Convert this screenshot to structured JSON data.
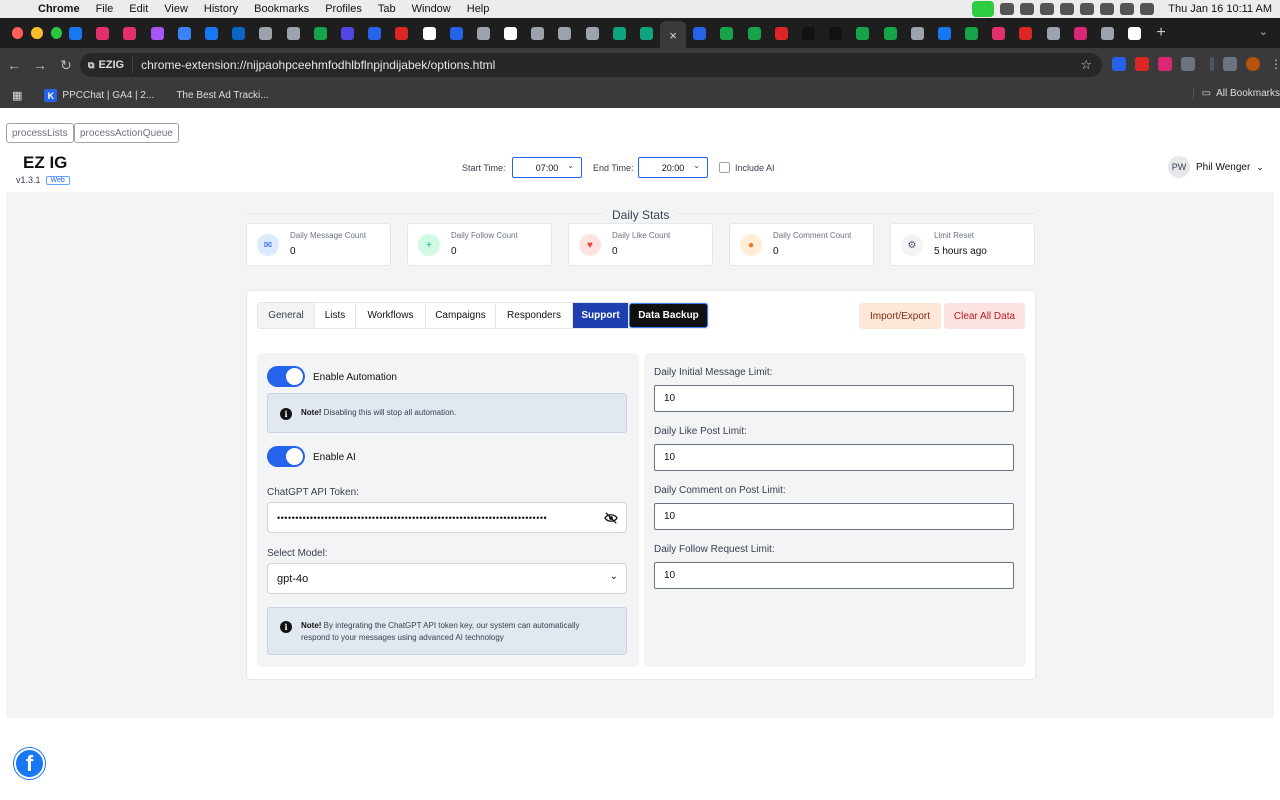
{
  "menubar": {
    "app": "Chrome",
    "items": [
      "File",
      "Edit",
      "View",
      "History",
      "Bookmarks",
      "Profiles",
      "Tab",
      "Window",
      "Help"
    ],
    "clock": "Thu Jan 16  10:11 AM"
  },
  "browser": {
    "url": "chrome-extension://nijpaohpceehmfodhlbflnpjndijabek/options.html",
    "site_chip": "EZIG",
    "new_tab": "+",
    "bookmarks": [
      {
        "label": "PPCChat | GA4 | 2...",
        "icon": "K"
      },
      {
        "label": "The Best Ad Tracki...",
        "icon": ""
      }
    ],
    "all_bookmarks": "All Bookmarks"
  },
  "debug_buttons": {
    "process_lists": "processLists",
    "process_action_queue": "processActionQueue"
  },
  "app": {
    "name": "EZ IG",
    "version": "v1.3.1",
    "badge": "Web"
  },
  "header": {
    "start_time_label": "Start Time:",
    "start_time": "07:00",
    "end_time_label": "End Time:",
    "end_time": "20:00",
    "include_ai_label": "Include AI",
    "user_initials": "PW",
    "user_name": "Phil Wenger"
  },
  "stats": {
    "title": "Daily Stats",
    "cards": [
      {
        "label": "Daily Message Count",
        "value": "0",
        "icon": "message-icon",
        "color": "#2563eb",
        "bg": "#dbeafe"
      },
      {
        "label": "Daily Follow Count",
        "value": "0",
        "icon": "user-plus-icon",
        "color": "#10b981",
        "bg": "#d1fae5"
      },
      {
        "label": "Daily Like Count",
        "value": "0",
        "icon": "heart-icon",
        "color": "#ef4444",
        "bg": "#fee2e2"
      },
      {
        "label": "Daily Comment Count",
        "value": "0",
        "icon": "comment-icon",
        "color": "#f97316",
        "bg": "#ffedd5"
      },
      {
        "label": "Limit Reset",
        "value": "5 hours ago",
        "icon": "gear-icon",
        "color": "#4b5563",
        "bg": "#f3f4f6"
      }
    ]
  },
  "tabs": [
    "General",
    "Lists",
    "Workflows",
    "Campaigns",
    "Responders",
    "Support",
    "Data Backup"
  ],
  "actions": {
    "import_export": "Import/Export",
    "clear_all": "Clear All Data"
  },
  "general": {
    "enable_automation": "Enable Automation",
    "automation_note_bold": "Note!",
    "automation_note": " Disabling this will stop all automation.",
    "enable_ai": "Enable AI",
    "token_label": "ChatGPT API Token:",
    "token_value": "••••••••••••••••••••••••••••••••••••••••••••••••••••••••••••••••••••••••••",
    "model_label": "Select Model:",
    "model_value": "gpt-4o",
    "ai_note_bold": "Note!",
    "ai_note_line1": " By integrating the ChatGPT API token key, our system can automatically",
    "ai_note_line2": "respond to your messages using advanced AI technology"
  },
  "limits": [
    {
      "label": "Daily Initial Message Limit:",
      "value": "10"
    },
    {
      "label": "Daily Like Post Limit:",
      "value": "10"
    },
    {
      "label": "Daily Comment on Post Limit:",
      "value": "10"
    },
    {
      "label": "Daily Follow Request Limit:",
      "value": "10"
    }
  ],
  "colors": {
    "accent": "#2563eb",
    "support": "#1e40af",
    "import_bg": "#fde7d9",
    "clear_bg": "#fde2e2"
  }
}
